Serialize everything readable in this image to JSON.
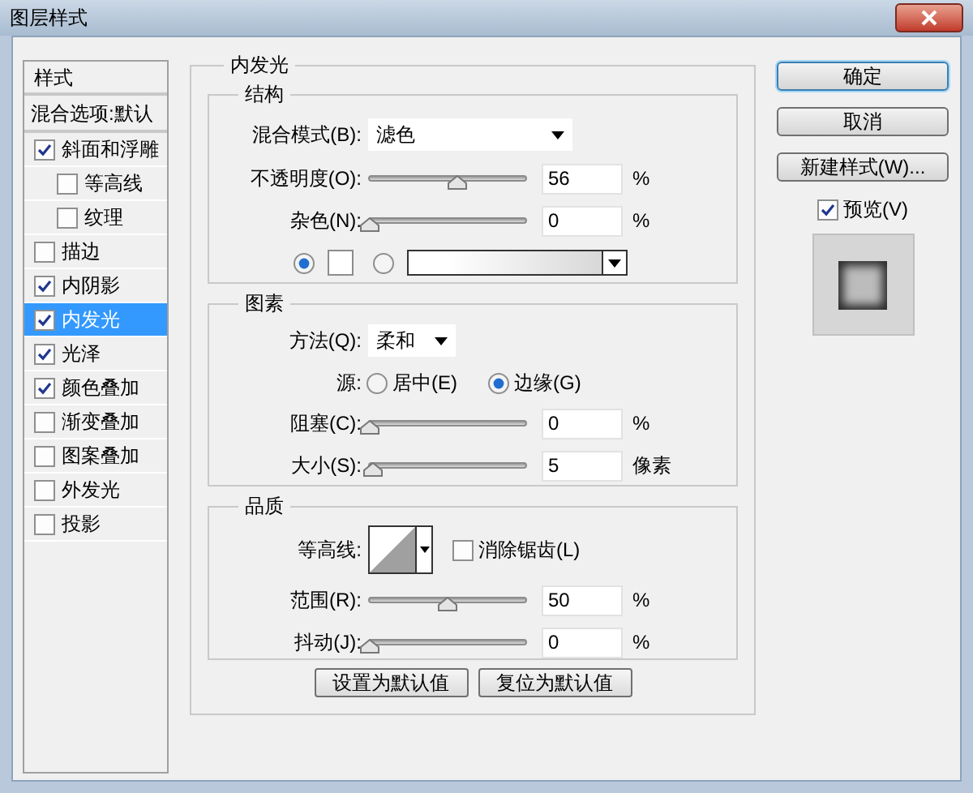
{
  "window": {
    "title": "图层样式"
  },
  "styles_panel": {
    "header": "样式",
    "blend_options": "混合选项:默认",
    "items": [
      {
        "label": "斜面和浮雕",
        "checked": true,
        "selected": false,
        "children": [
          {
            "label": "等高线",
            "checked": false,
            "selected": false
          },
          {
            "label": "纹理",
            "checked": false,
            "selected": false
          }
        ]
      },
      {
        "label": "描边",
        "checked": false,
        "selected": false
      },
      {
        "label": "内阴影",
        "checked": true,
        "selected": false
      },
      {
        "label": "内发光",
        "checked": true,
        "selected": true
      },
      {
        "label": "光泽",
        "checked": true,
        "selected": false
      },
      {
        "label": "颜色叠加",
        "checked": true,
        "selected": false
      },
      {
        "label": "渐变叠加",
        "checked": false,
        "selected": false
      },
      {
        "label": "图案叠加",
        "checked": false,
        "selected": false
      },
      {
        "label": "外发光",
        "checked": false,
        "selected": false
      },
      {
        "label": "投影",
        "checked": false,
        "selected": false
      }
    ]
  },
  "inner_glow": {
    "title": "内发光",
    "structure": {
      "title": "结构",
      "blend_mode": {
        "label": "混合模式(B):",
        "value": "滤色"
      },
      "sliders": [
        {
          "label": "不透明度(O):",
          "level": 0.56,
          "value": "56",
          "unit": "%"
        },
        {
          "label": "杂色(N):",
          "level": 0,
          "value": "0",
          "unit": "%"
        }
      ],
      "fill": [
        {
          "kind": "color",
          "selected": true
        },
        {
          "kind": "gradient",
          "selected": false
        }
      ]
    },
    "elements": {
      "title": "图素",
      "technique": {
        "label": "方法(Q):",
        "value": "柔和"
      },
      "source": {
        "label": "源:",
        "options": [
          {
            "label": "居中(E)",
            "selected": false
          },
          {
            "label": "边缘(G)",
            "selected": true
          }
        ]
      },
      "sliders": [
        {
          "label": "阻塞(C):",
          "level": 0,
          "value": "0",
          "unit": "%"
        },
        {
          "label": "大小(S):",
          "level": 0.02,
          "value": "5",
          "unit": "像素"
        }
      ]
    },
    "quality": {
      "title": "品质",
      "contour": {
        "label": "等高线:"
      },
      "anti_alias": {
        "label": "消除锯齿(L)",
        "checked": false
      },
      "sliders": [
        {
          "label": "范围(R):",
          "level": 0.5,
          "value": "50",
          "unit": "%"
        },
        {
          "label": "抖动(J):",
          "level": 0,
          "value": "0",
          "unit": "%"
        }
      ]
    },
    "buttons": [
      "设置为默认值",
      "复位为默认值"
    ]
  },
  "actions": {
    "buttons": [
      {
        "label": "确定",
        "default": true
      },
      {
        "label": "取消",
        "default": false
      },
      {
        "label": "新建样式(W)...",
        "default": false
      }
    ],
    "preview": {
      "label": "预览(V)",
      "checked": true
    }
  }
}
